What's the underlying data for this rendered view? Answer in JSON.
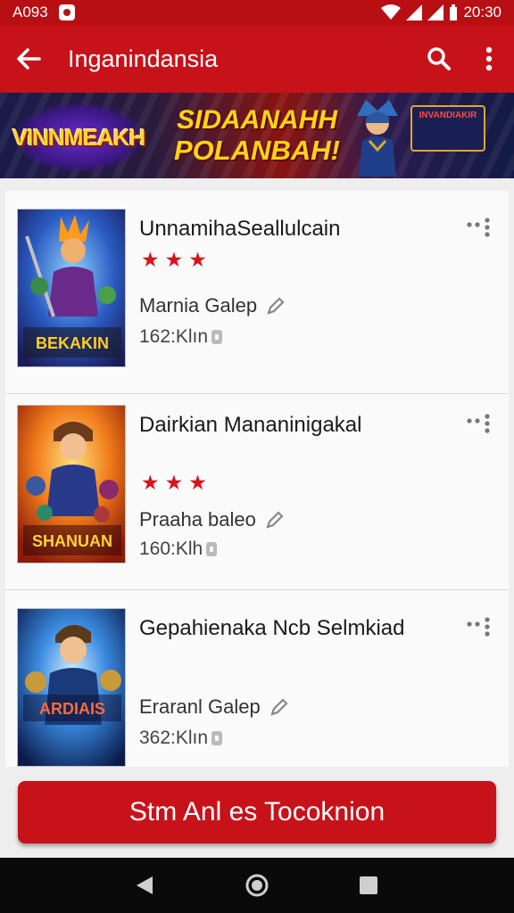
{
  "status_bar": {
    "left_text": "A093",
    "time": "20:30"
  },
  "app_bar": {
    "title": "Inganindansia"
  },
  "banner": {
    "logo_text": "VINNMEAKH",
    "headline_line1": "SIDAANAHH",
    "headline_line2": "POLANBAH!",
    "side_text": "INVANDIAKIR"
  },
  "items": [
    {
      "title": "UnnamihaSeallulcain",
      "stars": "★★★",
      "meta": "Marnia Galep",
      "size": "162:Klın",
      "cover_text": "BEKAKIN"
    },
    {
      "title": "Dairkian Mananinigakal",
      "stars": "★★★",
      "meta": "Praaha baleo",
      "size": "160:Klh",
      "cover_text": "SHANUAN"
    },
    {
      "title": "Gepahienaka Ncb Selmkiad",
      "stars": "",
      "meta": "Eraranl Galep",
      "size": "362:Klın",
      "cover_text": "ARDIAIS"
    }
  ],
  "cta": {
    "label": "Stm Anl es Tocoknion"
  },
  "colors": {
    "primary": "#c8121a",
    "status_bar": "#b80f14",
    "star": "#d6141c"
  }
}
